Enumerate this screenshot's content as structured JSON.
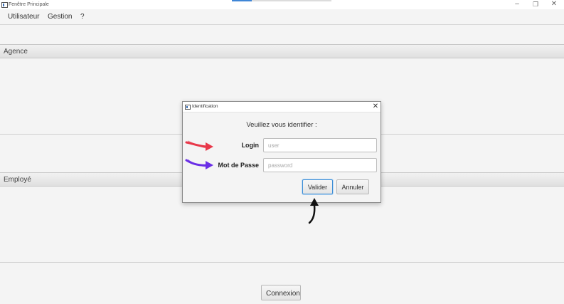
{
  "window": {
    "title": "Fenêtre Principale",
    "controls": {
      "minimize": "–",
      "maximize": "❐",
      "close": "✕"
    }
  },
  "menu": {
    "items": [
      {
        "label": "Utilisateur"
      },
      {
        "label": "Gestion"
      },
      {
        "label": "?"
      }
    ]
  },
  "sections": {
    "agence": {
      "title": "Agence"
    },
    "employe": {
      "title": "Employé"
    }
  },
  "footer": {
    "connexion_label": "Connexion"
  },
  "dialog": {
    "title": "Identification",
    "close": "✕",
    "prompt": "Veuillez vous identifier :",
    "login": {
      "label": "Login",
      "value": "",
      "placeholder": "user"
    },
    "password": {
      "label": "Mot de Passe",
      "value": "",
      "placeholder": "password"
    },
    "buttons": {
      "validate": "Valider",
      "cancel": "Annuler"
    }
  },
  "colors": {
    "arrow_login": "#e8384a",
    "arrow_password": "#6a2ee6",
    "arrow_button": "#111111",
    "focus_accent": "#3d8ed6"
  }
}
